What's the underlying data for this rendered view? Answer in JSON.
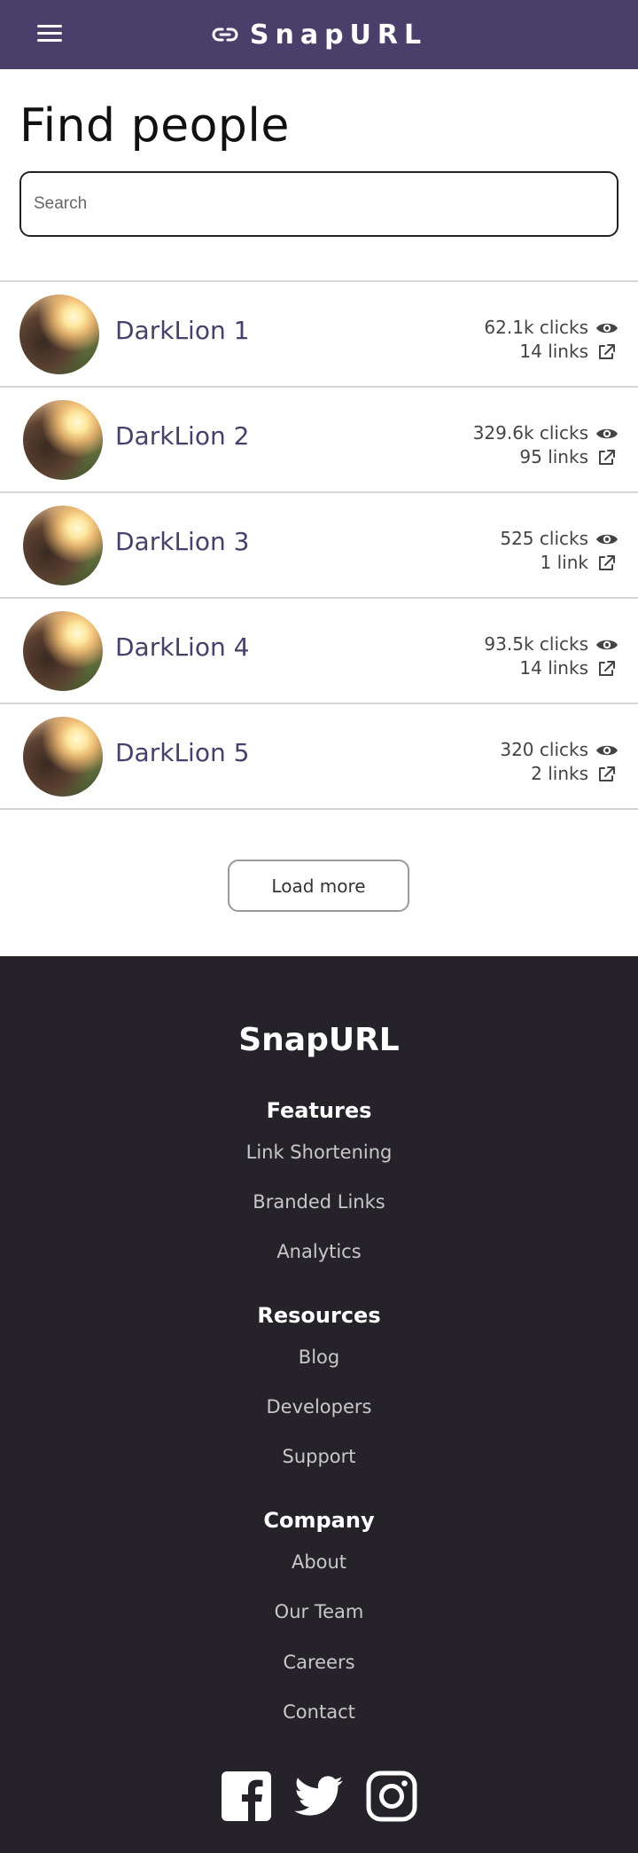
{
  "header": {
    "brand": "SnapURL",
    "menu_icon": "hamburger-menu-icon",
    "brand_icon": "link-icon"
  },
  "main": {
    "title": "Find people",
    "search": {
      "placeholder": "Search",
      "value": ""
    },
    "people": [
      {
        "name": "DarkLion 1",
        "clicks": "62.1k clicks",
        "links": "14 links"
      },
      {
        "name": "DarkLion 2",
        "clicks": "329.6k clicks",
        "links": "95 links"
      },
      {
        "name": "DarkLion 3",
        "clicks": "525 clicks",
        "links": "1 link"
      },
      {
        "name": "DarkLion 4",
        "clicks": "93.5k clicks",
        "links": "14 links"
      },
      {
        "name": "DarkLion 5",
        "clicks": "320 clicks",
        "links": "2 links"
      }
    ],
    "load_more": "Load more"
  },
  "footer": {
    "brand": "SnapURL",
    "sections": [
      {
        "heading": "Features",
        "links": [
          "Link Shortening",
          "Branded Links",
          "Analytics"
        ]
      },
      {
        "heading": "Resources",
        "links": [
          "Blog",
          "Developers",
          "Support"
        ]
      },
      {
        "heading": "Company",
        "links": [
          "About",
          "Our Team",
          "Careers",
          "Contact"
        ]
      }
    ],
    "socials": [
      "facebook-icon",
      "twitter-icon",
      "instagram-icon"
    ]
  },
  "colors": {
    "header_bg": "#4a3f6b",
    "name_color": "#4a3f6b",
    "footer_bg": "#252229"
  }
}
